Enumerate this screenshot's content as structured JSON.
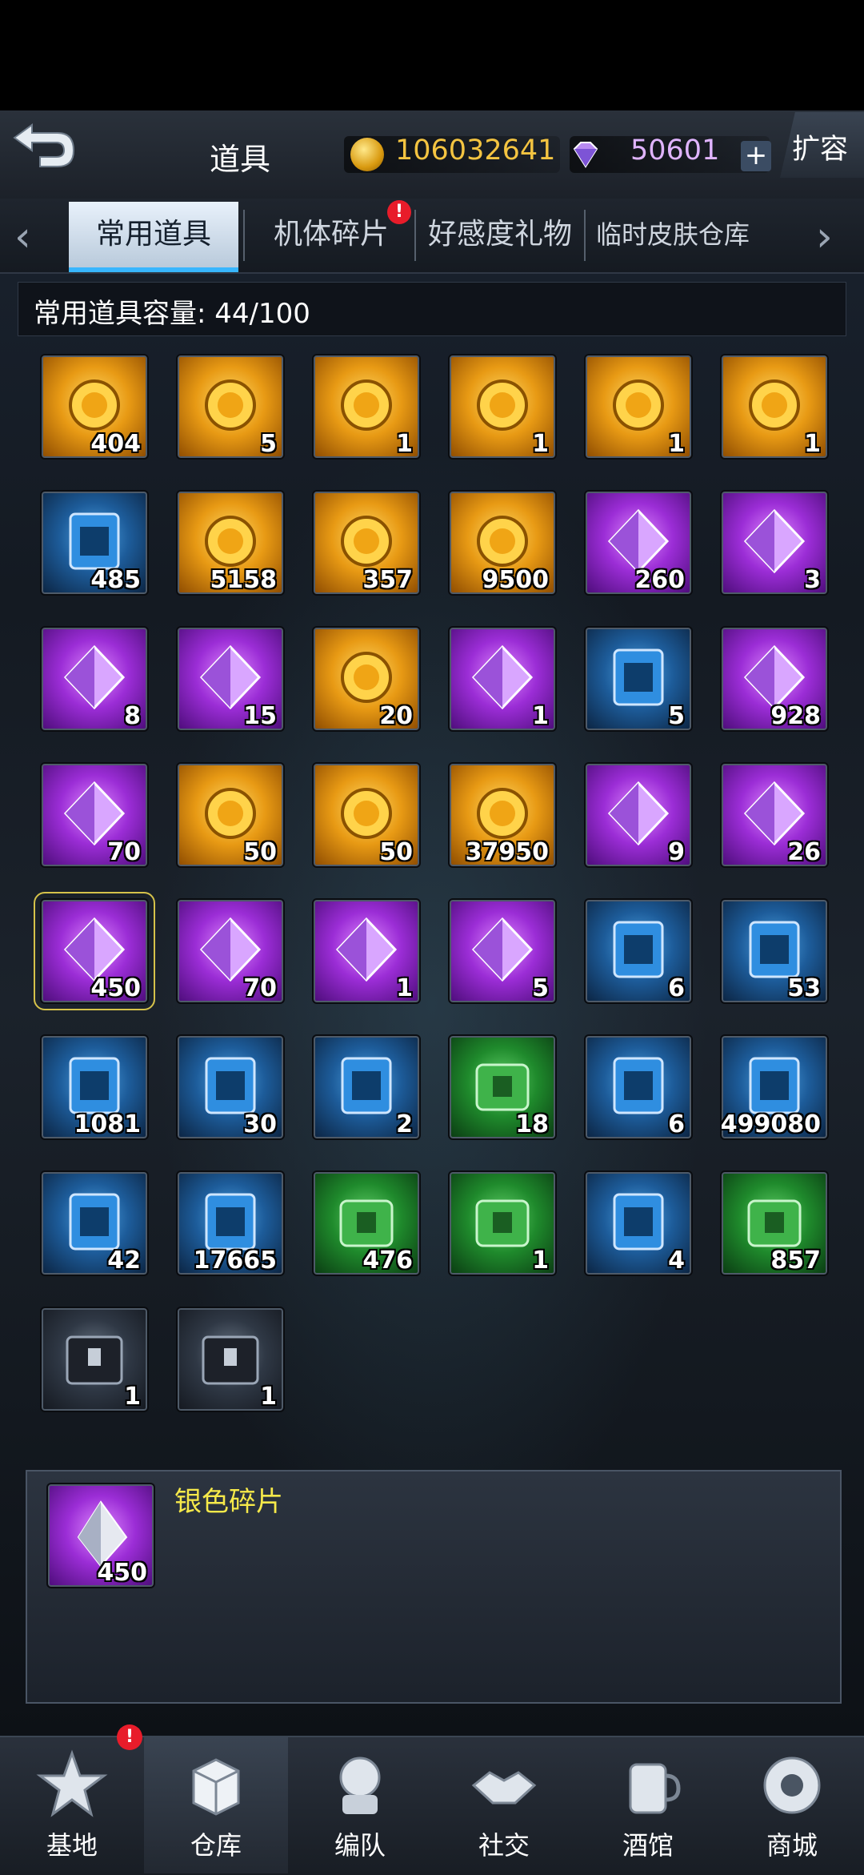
{
  "header": {
    "title": "道具",
    "coins": "106032641",
    "gems": "50601",
    "plus_label": "+",
    "expand_label": "扩容"
  },
  "tabs": [
    {
      "label": "常用道具",
      "active": true
    },
    {
      "label": "机体碎片",
      "badge": "!"
    },
    {
      "label": "好感度礼物"
    },
    {
      "label": "临时皮肤仓库"
    }
  ],
  "nav_arrows": {
    "left": "‹",
    "right": "›"
  },
  "capacity": "常用道具容量: 44/100",
  "items": [
    {
      "count": "404",
      "bg": "gold",
      "icon": "blue-cards-icon"
    },
    {
      "count": "5",
      "bg": "gold",
      "icon": "ship-ticket-icon"
    },
    {
      "count": "1",
      "bg": "gold",
      "icon": "refresh-card-icon"
    },
    {
      "count": "1",
      "bg": "gold",
      "icon": "gear-emblem-icon"
    },
    {
      "count": "1",
      "bg": "gold",
      "icon": "heart-gift-box-icon"
    },
    {
      "count": "1",
      "bg": "gold",
      "icon": "medal-wings-icon"
    },
    {
      "count": "485",
      "bg": "blue",
      "icon": "circuit-chip-icon"
    },
    {
      "count": "5158",
      "bg": "gold",
      "icon": "star-emblem-icon"
    },
    {
      "count": "357",
      "bg": "gold",
      "icon": "phoenix-coin-icon"
    },
    {
      "count": "9500",
      "bg": "gold",
      "icon": "gold-coin-icon"
    },
    {
      "count": "260",
      "bg": "purple",
      "icon": "capsule-icon"
    },
    {
      "count": "3",
      "bg": "purple",
      "icon": "blue-card-icon"
    },
    {
      "count": "8",
      "bg": "purple",
      "icon": "pink-crate-icon"
    },
    {
      "count": "15",
      "bg": "purple",
      "icon": "black-card-icon"
    },
    {
      "count": "20",
      "bg": "gold",
      "icon": "puzzle-piece-icon"
    },
    {
      "count": "1",
      "bg": "purple",
      "icon": "purple-puzzle-icon"
    },
    {
      "count": "5",
      "bg": "blue",
      "icon": "blue-crate-icon"
    },
    {
      "count": "928",
      "bg": "purple",
      "icon": "pink-gem-icon"
    },
    {
      "count": "70",
      "bg": "purple",
      "icon": "cap-icon"
    },
    {
      "count": "50",
      "bg": "gold",
      "icon": "coin-stack-icon"
    },
    {
      "count": "50",
      "bg": "gold",
      "icon": "coin-stack-icon"
    },
    {
      "count": "37950",
      "bg": "gold",
      "icon": "gold-badge-icon"
    },
    {
      "count": "9",
      "bg": "purple",
      "icon": "green-ball-icon"
    },
    {
      "count": "26",
      "bg": "purple",
      "icon": "watermelon-icon"
    },
    {
      "count": "450",
      "bg": "purple",
      "icon": "silver-shard-icon",
      "selected": true
    },
    {
      "count": "70",
      "bg": "purple",
      "icon": "gold-medal-icon"
    },
    {
      "count": "1",
      "bg": "purple",
      "icon": "robot-arm-icon"
    },
    {
      "count": "5",
      "bg": "purple",
      "icon": "crystal-icon"
    },
    {
      "count": "6",
      "bg": "blue",
      "icon": "map-scroll-icon"
    },
    {
      "count": "53",
      "bg": "blue",
      "icon": "blue-card-icon"
    },
    {
      "count": "1081",
      "bg": "blue",
      "icon": "battery-icon"
    },
    {
      "count": "30",
      "bg": "blue",
      "icon": "target-poster-icon"
    },
    {
      "count": "2",
      "bg": "blue",
      "icon": "gift-box-icon"
    },
    {
      "count": "18",
      "bg": "green",
      "icon": "green-crate-icon"
    },
    {
      "count": "6",
      "bg": "blue",
      "icon": "wanted-poster-icon"
    },
    {
      "count": "499080",
      "bg": "blue",
      "icon": "green-gem-icon"
    },
    {
      "count": "42",
      "bg": "blue",
      "icon": "coating-can-icon"
    },
    {
      "count": "17665",
      "bg": "blue",
      "icon": "blue-crystal-icon"
    },
    {
      "count": "476",
      "bg": "green",
      "icon": "pill-capsule-icon"
    },
    {
      "count": "1",
      "bg": "green",
      "icon": "treasure-chest-icon"
    },
    {
      "count": "4",
      "bg": "blue",
      "icon": "coating-can-icon"
    },
    {
      "count": "857",
      "bg": "green",
      "icon": "red-badge-icon"
    },
    {
      "count": "1",
      "bg": "dark",
      "icon": "black-box-ii-icon"
    },
    {
      "count": "1",
      "bg": "dark",
      "icon": "black-box-i-icon"
    }
  ],
  "detail": {
    "name": "银色碎片",
    "count": "450",
    "icon": "silver-shard-icon"
  },
  "bottom_nav": [
    {
      "label": "基地",
      "icon": "base-icon",
      "badge": "!"
    },
    {
      "label": "仓库",
      "icon": "warehouse-icon",
      "active": true
    },
    {
      "label": "编队",
      "icon": "team-icon"
    },
    {
      "label": "社交",
      "icon": "handshake-icon"
    },
    {
      "label": "酒馆",
      "icon": "tavern-icon"
    },
    {
      "label": "商城",
      "icon": "shop-icon"
    }
  ]
}
